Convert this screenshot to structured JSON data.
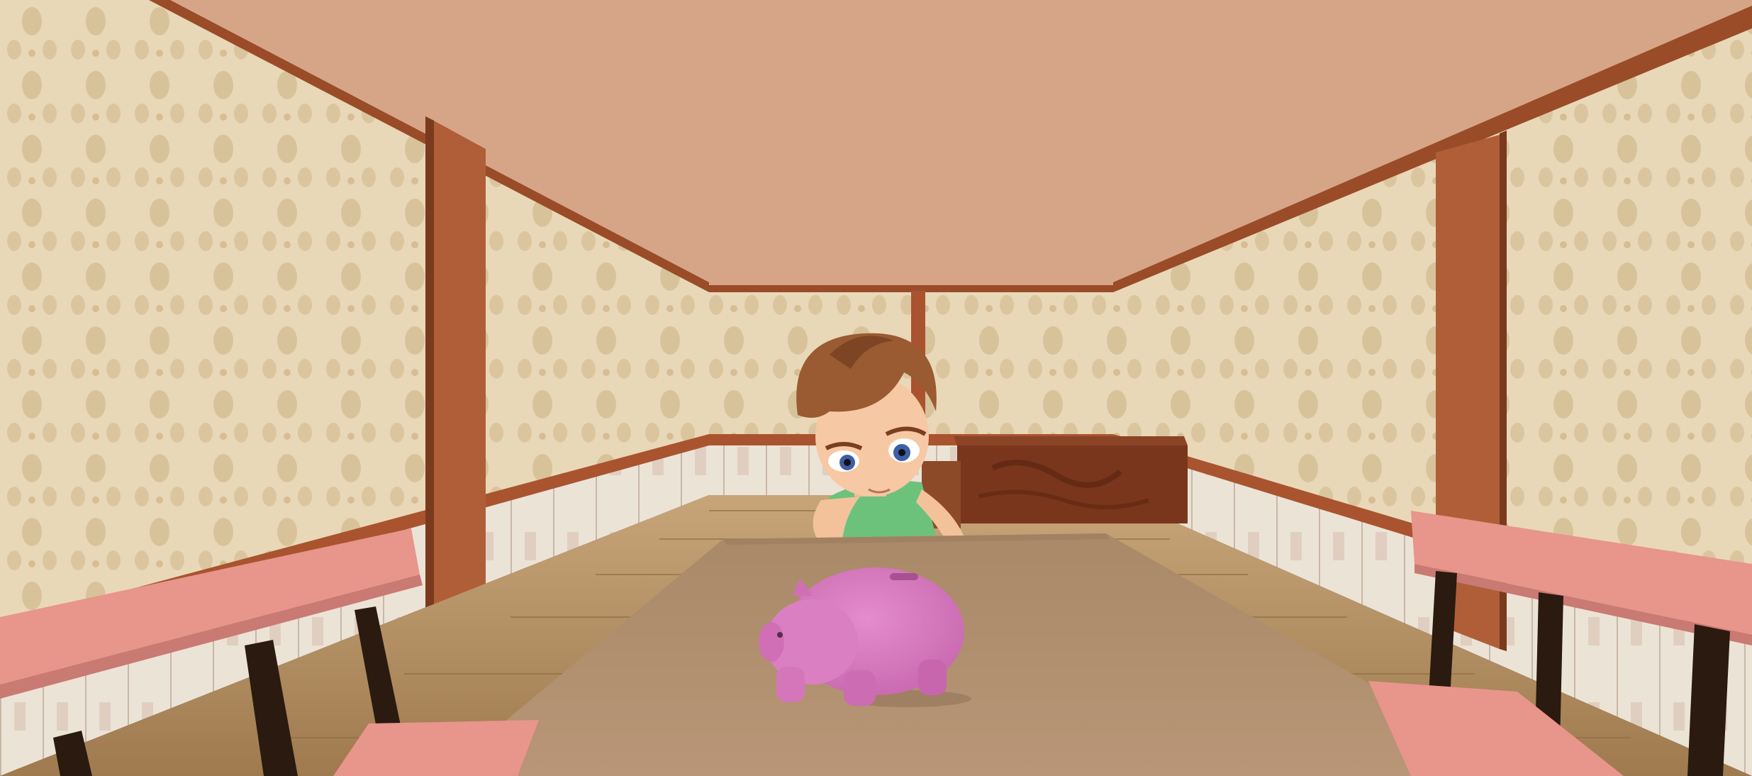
{
  "scene": {
    "description_visible_text": "",
    "colors": {
      "ceiling": "#d7a689",
      "wallpaper": "#e6d4b3",
      "wallpaper_pattern": "#cdb084",
      "wood_trim": "#a9542f",
      "wood_trim_dark": "#7a3a1e",
      "floor": "#b08a5c",
      "floor_lines": "#8c6a43",
      "wainscot": "#e8ddd0",
      "table_top": "#b08e70",
      "chair_seat": "#e8958c",
      "chair_legs": "#2a1a10",
      "piggy": "#de80c4",
      "piggy_shadow": "#b95fa2",
      "cabinet": "#7d3a1f",
      "hair": "#9a5a32",
      "skin": "#f5c7a1",
      "shirt": "#6ec27a"
    },
    "icons": [
      "girl-character",
      "piggy-bank",
      "wooden-cabinet",
      "dining-table",
      "chair-left",
      "chair-right"
    ]
  }
}
